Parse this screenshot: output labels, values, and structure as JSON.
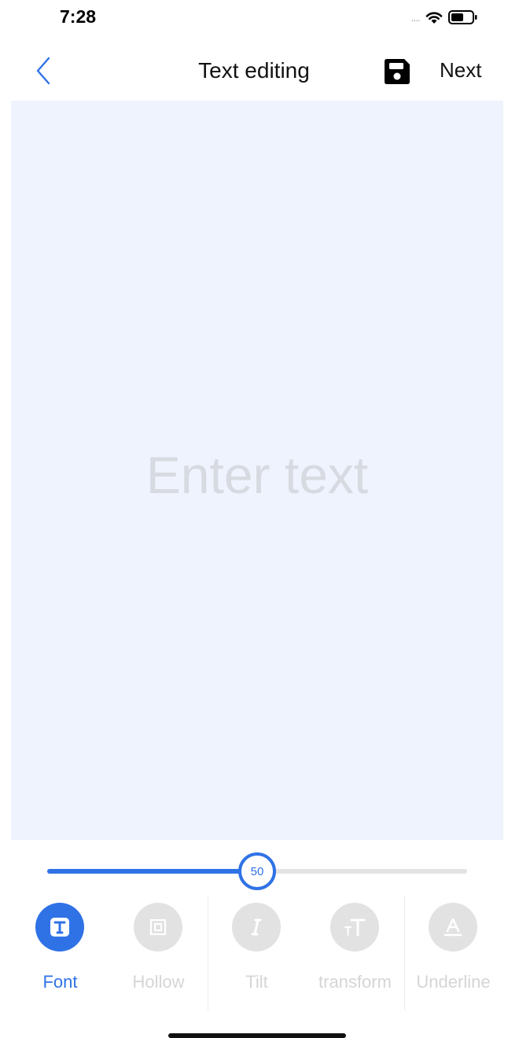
{
  "status_bar": {
    "time": "7:28",
    "signal": "....",
    "battery_level": 0.6
  },
  "nav": {
    "title": "Text editing",
    "next_label": "Next",
    "back_icon": "chevron-left-icon",
    "save_icon": "floppy-disk-icon"
  },
  "canvas": {
    "placeholder": "Enter text",
    "background": "#eff3fd"
  },
  "slider": {
    "value": "50",
    "fraction": 0.5
  },
  "toolbar": {
    "items": [
      {
        "label": "Font",
        "icon": "font-icon",
        "active": true
      },
      {
        "label": "Hollow",
        "icon": "hollow-icon",
        "active": false
      },
      {
        "label": "Tilt",
        "icon": "italic-icon",
        "active": false
      },
      {
        "label": "transform",
        "icon": "text-size-icon",
        "active": false
      },
      {
        "label": "Underline",
        "icon": "underline-icon",
        "active": false
      }
    ]
  },
  "colors": {
    "accent": "#2f72e6",
    "inactive": "#e2e2e2",
    "inactive_text": "#d5d5d5"
  }
}
